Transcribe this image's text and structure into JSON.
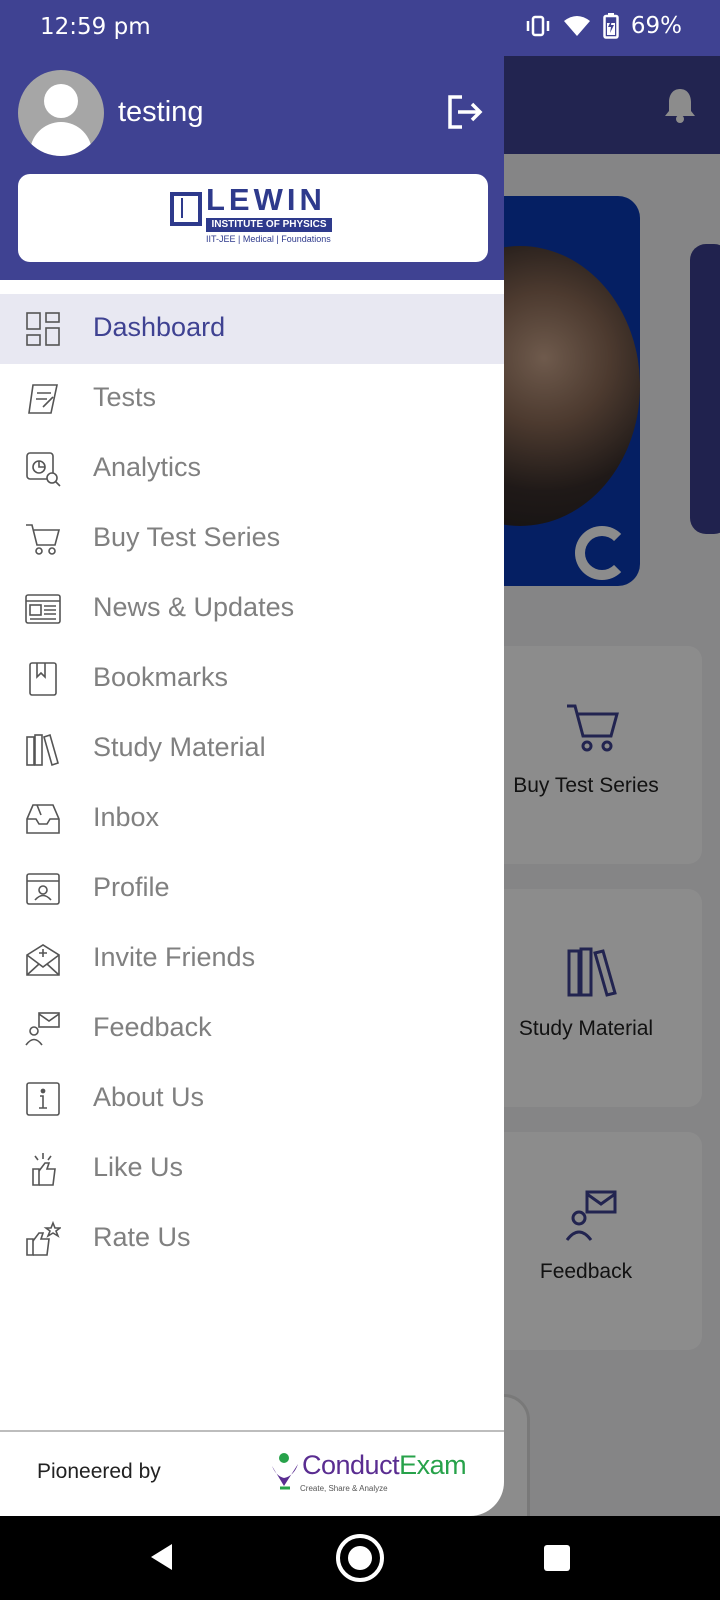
{
  "status_bar": {
    "time": "12:59 pm",
    "battery": "69%"
  },
  "background": {
    "cards": [
      {
        "label": "Buy Test Series",
        "icon": "cart-icon"
      },
      {
        "label": "Study Material",
        "icon": "books-icon"
      },
      {
        "label": "Feedback",
        "icon": "feedback-icon"
      }
    ]
  },
  "drawer": {
    "username": "testing",
    "logo": {
      "title": "LEWIN",
      "line1": "INSTITUTE OF PHYSICS",
      "line2": "IIT-JEE | Medical | Foundations"
    },
    "menu": [
      {
        "label": "Dashboard",
        "icon": "dashboard-icon",
        "active": true
      },
      {
        "label": "Tests",
        "icon": "tests-icon"
      },
      {
        "label": "Analytics",
        "icon": "analytics-icon"
      },
      {
        "label": "Buy Test Series",
        "icon": "cart-icon"
      },
      {
        "label": "News & Updates",
        "icon": "news-icon"
      },
      {
        "label": "Bookmarks",
        "icon": "bookmark-icon"
      },
      {
        "label": "Study Material",
        "icon": "books-icon"
      },
      {
        "label": "Inbox",
        "icon": "inbox-icon"
      },
      {
        "label": "Profile",
        "icon": "profile-icon"
      },
      {
        "label": "Invite Friends",
        "icon": "invite-icon"
      },
      {
        "label": "Feedback",
        "icon": "feedback-icon"
      },
      {
        "label": "About Us",
        "icon": "info-icon"
      },
      {
        "label": "Like Us",
        "icon": "like-icon"
      },
      {
        "label": "Rate Us",
        "icon": "rate-icon"
      }
    ],
    "footer": {
      "pioneered_by": "Pioneered by",
      "brand_a": "Conduct",
      "brand_b": "Exam",
      "tagline": "Create, Share & Analyze"
    }
  },
  "colors": {
    "primary": "#3f4292",
    "menu_text": "#808080",
    "active_bg": "#e8e8f2"
  }
}
